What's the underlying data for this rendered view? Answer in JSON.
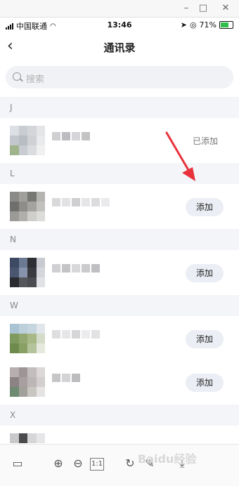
{
  "window": {
    "minimize_icon": "–",
    "maximize_icon": "□",
    "close_icon": "✕"
  },
  "status": {
    "carrier": "中国联通",
    "time": "13:46",
    "battery": "71%"
  },
  "nav": {
    "back_icon": "‹",
    "title": "通讯录"
  },
  "search": {
    "placeholder": "搜索"
  },
  "sections": [
    {
      "letter": "J"
    },
    {
      "letter": "L"
    },
    {
      "letter": "N"
    },
    {
      "letter": "W"
    },
    {
      "letter": "X"
    }
  ],
  "contacts": [
    {
      "action_label": "已添加",
      "action_type": "added"
    },
    {
      "action_label": "添加",
      "action_type": "add"
    },
    {
      "action_label": "添加",
      "action_type": "add"
    },
    {
      "action_label": "添加",
      "action_type": "add"
    },
    {
      "action_label": "添加",
      "action_type": "add"
    }
  ],
  "colors": {
    "accent_red": "#e8323c",
    "chip_bg": "#eceef5",
    "section_bg": "#f4f5f8"
  },
  "toolbar": {
    "zoom_label": "1:1"
  },
  "watermark": {
    "text": "Baidu经验"
  }
}
